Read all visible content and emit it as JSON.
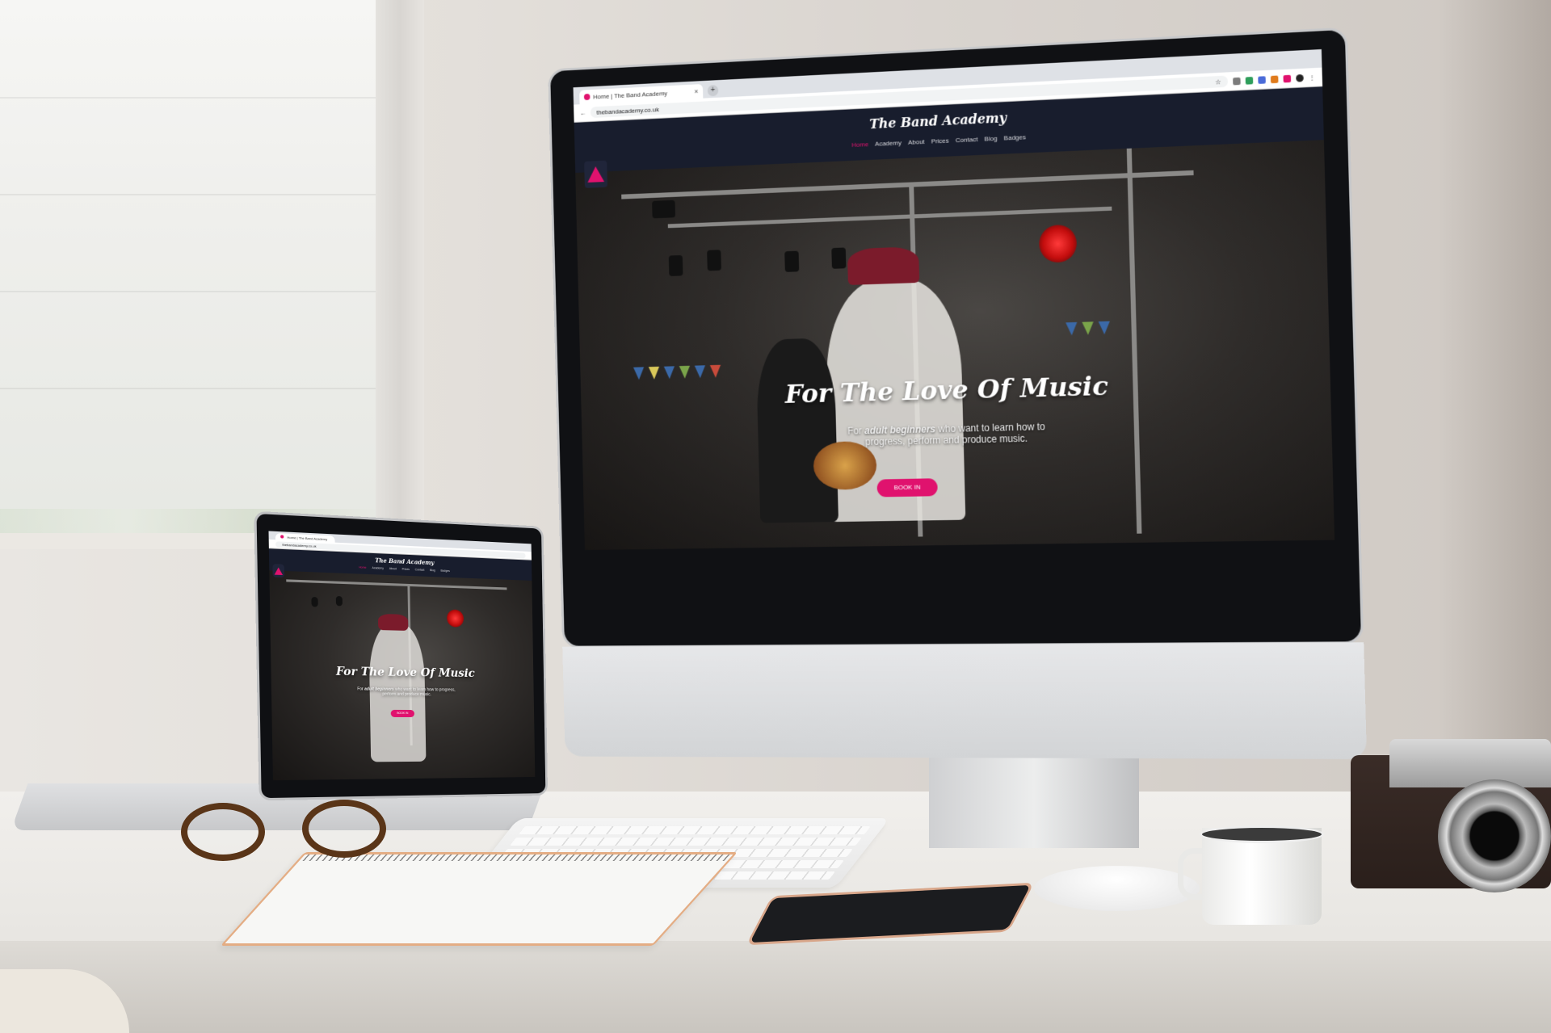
{
  "browser": {
    "tab_title": "Home | The Band Academy",
    "tab_close": "×",
    "new_tab": "+",
    "url": "thebandacademy.co.uk",
    "tooltip": "Home | The Band Academy"
  },
  "site": {
    "brand": "The Band Academy",
    "nav": [
      "Home",
      "Academy",
      "About",
      "Prices",
      "Contact",
      "Blog",
      "Badges"
    ],
    "active_nav": "Home",
    "hero": {
      "title": "For The Love Of Music",
      "text_prefix": "For",
      "text_bold": "adult beginners",
      "text_suffix": "who want to learn how to progress, perform and produce music.",
      "button": "BOOK IN"
    }
  },
  "colors": {
    "accent": "#e0126e",
    "nav_bg": "#181d2d"
  },
  "icons": [
    "back-arrow-icon",
    "star-icon",
    "extension-icons",
    "menu-dots-icon",
    "site-logo-icon"
  ]
}
